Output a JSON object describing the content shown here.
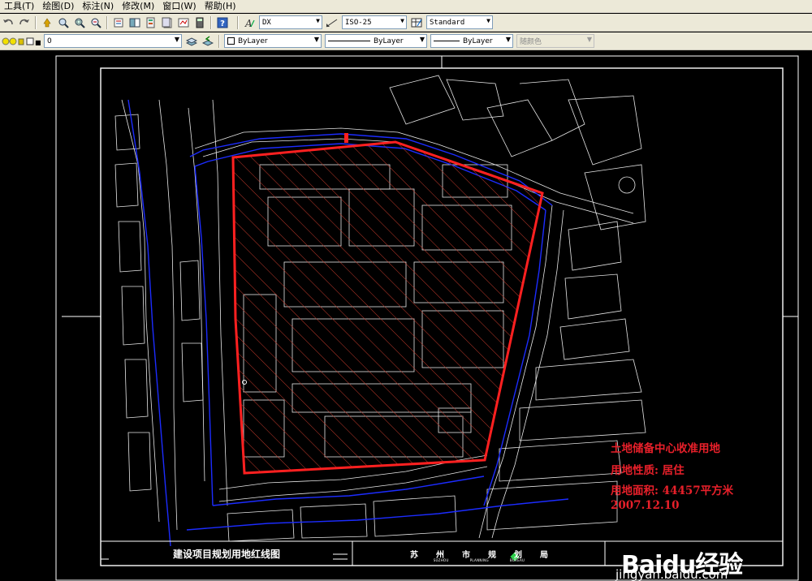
{
  "menu": [
    "工具(T)",
    "绘图(D)",
    "标注(N)",
    "修改(M)",
    "窗口(W)",
    "帮助(H)"
  ],
  "styles": {
    "text_style": "DX",
    "dim_style": "ISO-25",
    "table_style": "Standard"
  },
  "layers": {
    "current_layer": "0",
    "color": "ByLayer",
    "linetype": "ByLayer",
    "lineweight": "ByLayer",
    "plot_style": "随颜色"
  },
  "drawing": {
    "annotations": [
      "土地储备中心收准用地",
      "用地性质: 居住",
      "用地面积: 44457平方米",
      "2007.12.10"
    ],
    "title_block": {
      "title": "建设项目规划用地红线图",
      "bureau_chars": [
        "苏",
        "州",
        "市",
        "规",
        "划",
        "局"
      ],
      "bureau_en": [
        "SUZHOU",
        "PLANNING",
        "BUREAU"
      ]
    },
    "colors": {
      "boundary": "#ff2020",
      "linework": "#ffffff",
      "water": "#1c2cff",
      "background": "#000000"
    }
  },
  "watermark": {
    "brand": "Baidu经验",
    "url": "jingyan.baidu.com"
  }
}
